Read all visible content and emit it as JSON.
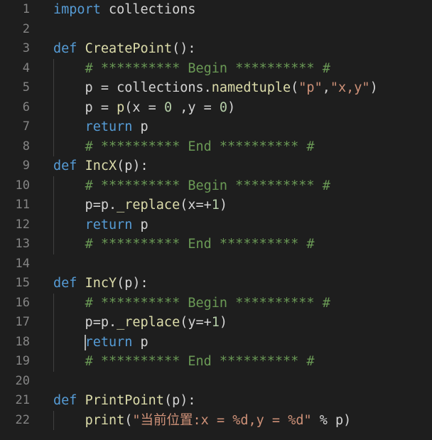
{
  "editor": {
    "language": "python",
    "lines": [
      {
        "n": "1",
        "tokens": [
          {
            "t": "import",
            "c": "kw"
          },
          {
            "t": " collections",
            "c": "id"
          }
        ]
      },
      {
        "n": "2",
        "tokens": []
      },
      {
        "n": "3",
        "tokens": [
          {
            "t": "def",
            "c": "kw"
          },
          {
            "t": " ",
            "c": "id"
          },
          {
            "t": "CreatePoint",
            "c": "fn"
          },
          {
            "t": "():",
            "c": "id"
          }
        ]
      },
      {
        "n": "4",
        "tokens": [
          {
            "t": "    ",
            "c": "id"
          },
          {
            "t": "# ********** Begin ********** #",
            "c": "cm"
          }
        ]
      },
      {
        "n": "5",
        "tokens": [
          {
            "t": "    p = collections.",
            "c": "id"
          },
          {
            "t": "namedtuple",
            "c": "fn"
          },
          {
            "t": "(",
            "c": "id"
          },
          {
            "t": "\"p\"",
            "c": "str"
          },
          {
            "t": ",",
            "c": "id"
          },
          {
            "t": "\"x,y\"",
            "c": "str"
          },
          {
            "t": ")",
            "c": "id"
          }
        ]
      },
      {
        "n": "6",
        "tokens": [
          {
            "t": "    p = ",
            "c": "id"
          },
          {
            "t": "p",
            "c": "fn"
          },
          {
            "t": "(x = ",
            "c": "id"
          },
          {
            "t": "0",
            "c": "num"
          },
          {
            "t": " ,y = ",
            "c": "id"
          },
          {
            "t": "0",
            "c": "num"
          },
          {
            "t": ")",
            "c": "id"
          }
        ]
      },
      {
        "n": "7",
        "tokens": [
          {
            "t": "    ",
            "c": "id"
          },
          {
            "t": "return",
            "c": "kw"
          },
          {
            "t": " p",
            "c": "id"
          }
        ]
      },
      {
        "n": "8",
        "tokens": [
          {
            "t": "    ",
            "c": "id"
          },
          {
            "t": "# ********** End ********** #",
            "c": "cm"
          }
        ]
      },
      {
        "n": "9",
        "tokens": [
          {
            "t": "def",
            "c": "kw"
          },
          {
            "t": " ",
            "c": "id"
          },
          {
            "t": "IncX",
            "c": "fn"
          },
          {
            "t": "(p):",
            "c": "id"
          }
        ]
      },
      {
        "n": "10",
        "tokens": [
          {
            "t": "    ",
            "c": "id"
          },
          {
            "t": "# ********** Begin ********** #",
            "c": "cm"
          }
        ]
      },
      {
        "n": "11",
        "tokens": [
          {
            "t": "    p=p.",
            "c": "id"
          },
          {
            "t": "_replace",
            "c": "fn"
          },
          {
            "t": "(x=+",
            "c": "id"
          },
          {
            "t": "1",
            "c": "num"
          },
          {
            "t": ")",
            "c": "id"
          }
        ]
      },
      {
        "n": "12",
        "tokens": [
          {
            "t": "    ",
            "c": "id"
          },
          {
            "t": "return",
            "c": "kw"
          },
          {
            "t": " p",
            "c": "id"
          }
        ]
      },
      {
        "n": "13",
        "tokens": [
          {
            "t": "    ",
            "c": "id"
          },
          {
            "t": "# ********** End ********** #",
            "c": "cm"
          }
        ]
      },
      {
        "n": "14",
        "tokens": []
      },
      {
        "n": "15",
        "tokens": [
          {
            "t": "def",
            "c": "kw"
          },
          {
            "t": " ",
            "c": "id"
          },
          {
            "t": "IncY",
            "c": "fn"
          },
          {
            "t": "(p):",
            "c": "id"
          }
        ]
      },
      {
        "n": "16",
        "tokens": [
          {
            "t": "    ",
            "c": "id"
          },
          {
            "t": "# ********** Begin ********** #",
            "c": "cm"
          }
        ]
      },
      {
        "n": "17",
        "tokens": [
          {
            "t": "    p=p.",
            "c": "id"
          },
          {
            "t": "_replace",
            "c": "fn"
          },
          {
            "t": "(y=+",
            "c": "id"
          },
          {
            "t": "1",
            "c": "num"
          },
          {
            "t": ")",
            "c": "id"
          }
        ]
      },
      {
        "n": "18",
        "tokens": [
          {
            "t": "    ",
            "c": "id"
          },
          {
            "t": "return",
            "c": "kw"
          },
          {
            "t": " p",
            "c": "id"
          }
        ]
      },
      {
        "n": "19",
        "tokens": [
          {
            "t": "    ",
            "c": "id"
          },
          {
            "t": "# ********** End ********** #",
            "c": "cm"
          }
        ]
      },
      {
        "n": "20",
        "tokens": []
      },
      {
        "n": "21",
        "tokens": [
          {
            "t": "def",
            "c": "kw"
          },
          {
            "t": " ",
            "c": "id"
          },
          {
            "t": "PrintPoint",
            "c": "fn"
          },
          {
            "t": "(p):",
            "c": "id"
          }
        ]
      },
      {
        "n": "22",
        "tokens": [
          {
            "t": "    ",
            "c": "id"
          },
          {
            "t": "print",
            "c": "fn"
          },
          {
            "t": "(",
            "c": "id"
          },
          {
            "t": "\"当前位置:x = %d,y = %d\"",
            "c": "str"
          },
          {
            "t": " % p)",
            "c": "id"
          }
        ]
      }
    ],
    "cursor_line": "18",
    "colors": {
      "background": "#1e1e1e",
      "line_number": "#858585",
      "keyword": "#569cd6",
      "function": "#dcdcaa",
      "string": "#ce9178",
      "number": "#b5cea8",
      "comment": "#6a9955",
      "text": "#d4d4d4"
    }
  }
}
